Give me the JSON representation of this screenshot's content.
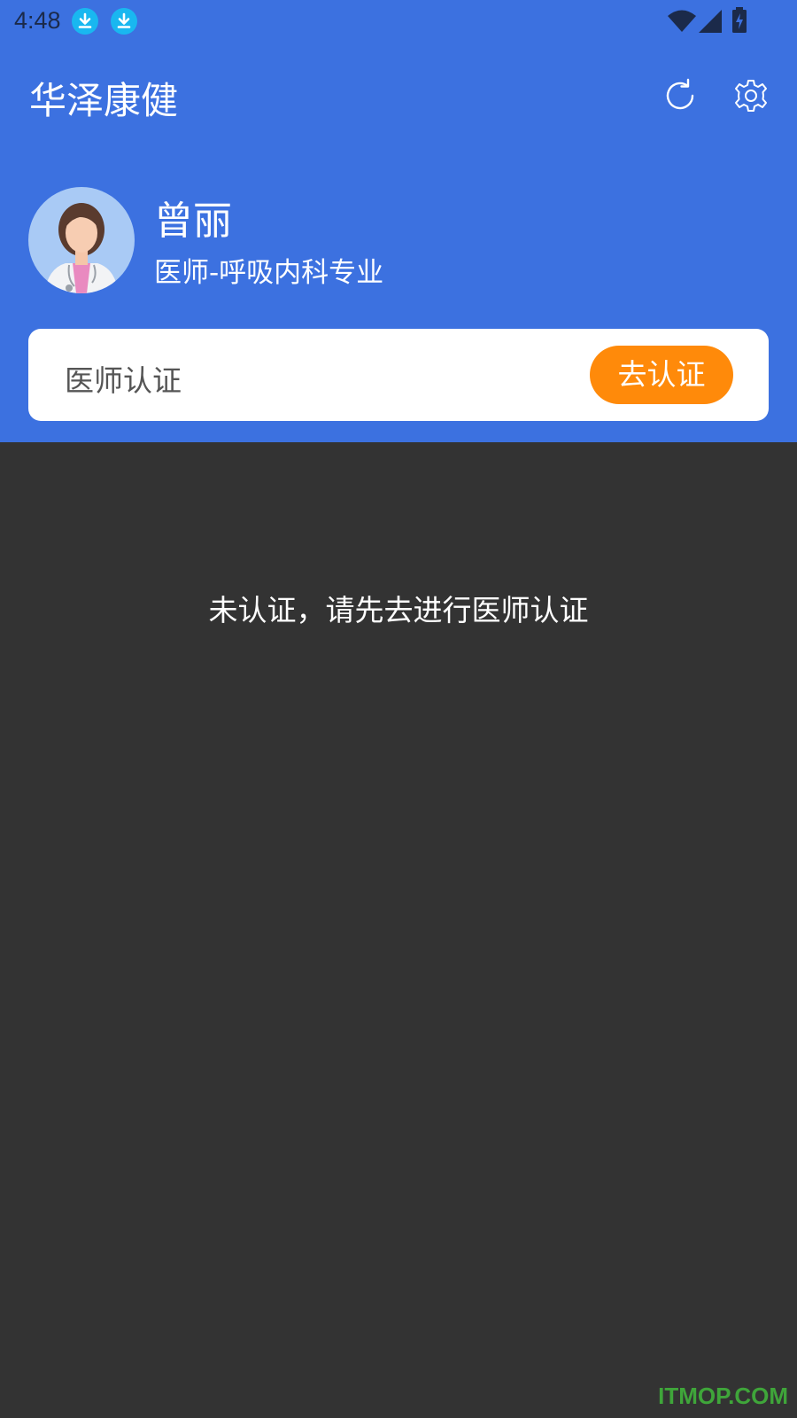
{
  "status_bar": {
    "time": "4:48",
    "icons": [
      "download-icon",
      "download-icon",
      "wifi-icon",
      "signal-icon",
      "battery-charging-icon"
    ]
  },
  "app_bar": {
    "title": "华泽康健",
    "actions": [
      "refresh-icon",
      "settings-icon"
    ]
  },
  "profile": {
    "name": "曾丽",
    "title": "医师-呼吸内科专业"
  },
  "certification": {
    "label": "医师认证",
    "button_label": "去认证"
  },
  "main": {
    "message": "未认证，请先去进行医师认证"
  },
  "watermark": "ITMOP.COM",
  "colors": {
    "header": "#3C71E0",
    "body": "#333333",
    "button": "#FF8A0A",
    "card": "#FFFFFF",
    "watermark": "#3FA53A"
  }
}
